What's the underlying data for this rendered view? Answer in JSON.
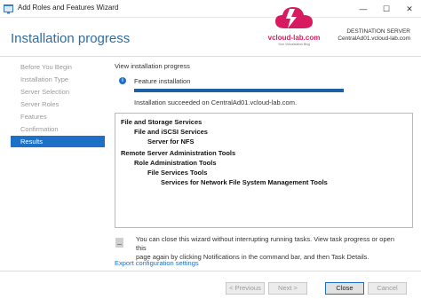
{
  "window": {
    "title": "Add Roles and Features Wizard",
    "controls": {
      "minimize": "—",
      "maximize": "☐",
      "close": "✕"
    }
  },
  "header": {
    "title": "Installation progress",
    "destination_label": "DESTINATION SERVER",
    "destination_value": "CentralAd01.vcloud-lab.com"
  },
  "logo": {
    "text": "vcloud-lab.com",
    "tagline": "Your Virtualization Blog"
  },
  "sidebar": {
    "items": [
      {
        "label": "Before You Begin",
        "active": false
      },
      {
        "label": "Installation Type",
        "active": false
      },
      {
        "label": "Server Selection",
        "active": false
      },
      {
        "label": "Server Roles",
        "active": false
      },
      {
        "label": "Features",
        "active": false
      },
      {
        "label": "Confirmation",
        "active": false
      },
      {
        "label": "Results",
        "active": true
      }
    ]
  },
  "main": {
    "section_title": "View installation progress",
    "progress": {
      "label": "Feature installation",
      "percent": 100,
      "status": "Installation succeeded on CentralAd01.vcloud-lab.com."
    },
    "results": [
      {
        "text": "File and Storage Services",
        "level": 0
      },
      {
        "text": "File and iSCSI Services",
        "level": 1
      },
      {
        "text": "Server for NFS",
        "level": 2
      },
      {
        "text": "Remote Server Administration Tools",
        "level": 0
      },
      {
        "text": "Role Administration Tools",
        "level": 1
      },
      {
        "text": "File Services Tools",
        "level": 2
      },
      {
        "text": "Services for Network File System Management Tools",
        "level": 3
      }
    ],
    "note_line1": "You can close this wizard without interrupting running tasks. View task progress or open this",
    "note_line2": "page again by clicking Notifications in the command bar, and then Task Details.",
    "export_link": "Export configuration settings"
  },
  "footer": {
    "previous_label": "< Previous",
    "next_label": "Next >",
    "close_label": "Close",
    "cancel_label": "Cancel"
  },
  "colors": {
    "accent": "#1e6fc6",
    "header_title": "#2e6da4",
    "logo": "#d81b60"
  },
  "icons": [
    "wizard-app-icon",
    "info-icon",
    "notifications-note-icon",
    "vcloud-logo-icon"
  ]
}
